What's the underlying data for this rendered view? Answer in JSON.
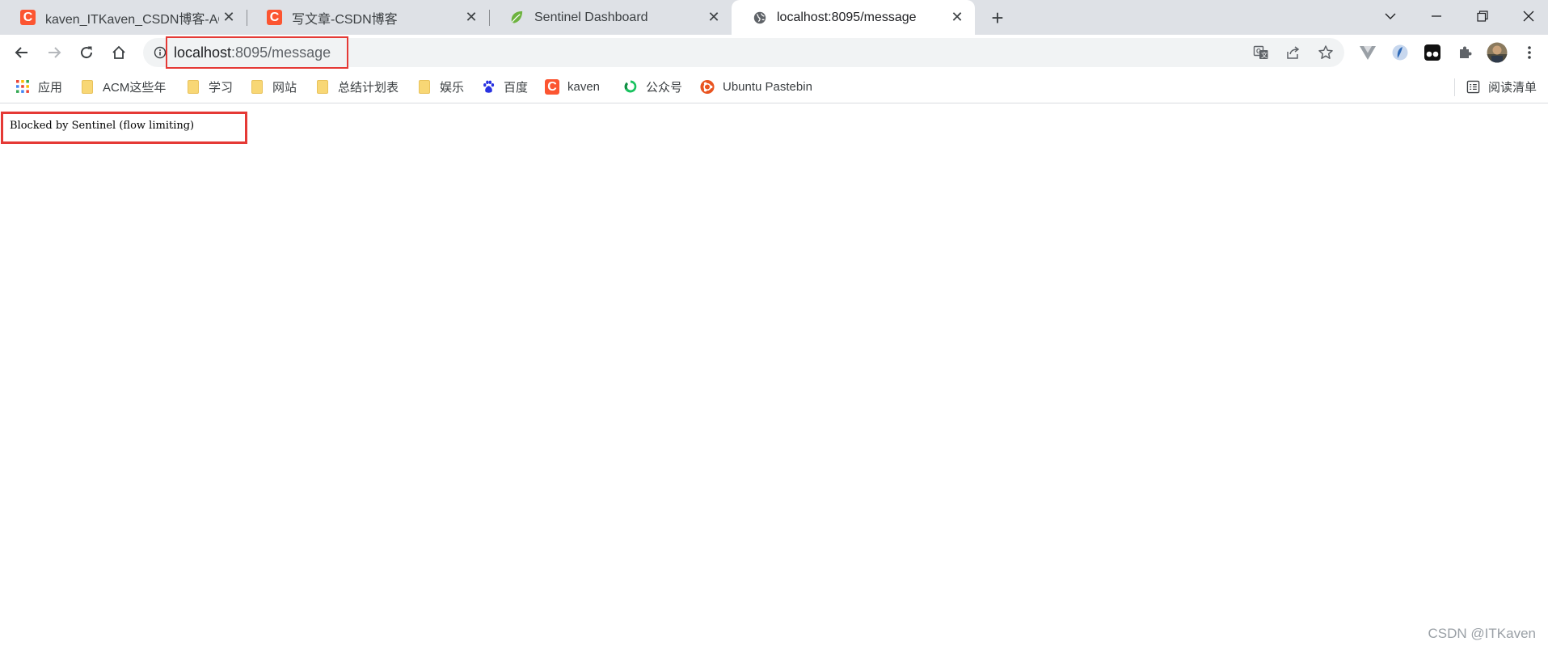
{
  "browser": {
    "tabs": [
      {
        "title": "kaven_ITKaven_CSDN博客-ACM",
        "icon": "csdn-icon",
        "favicon_char": "C",
        "active": false
      },
      {
        "title": "写文章-CSDN博客",
        "icon": "csdn-icon",
        "favicon_char": "C",
        "active": false
      },
      {
        "title": "Sentinel Dashboard",
        "icon": "spring-leaf-icon",
        "active": false
      },
      {
        "title": "localhost:8095/message",
        "icon": "globe-icon",
        "active": true
      }
    ],
    "close_glyph": "✕",
    "new_tab_glyph": "+",
    "window_controls": [
      "chevron-down-icon",
      "minimize-icon",
      "restore-icon",
      "close-icon"
    ]
  },
  "toolbar": {
    "url_host": "localhost",
    "url_rest": ":8095/message",
    "nav_icons": [
      "back-arrow-icon",
      "forward-arrow-icon",
      "reload-icon",
      "home-icon"
    ],
    "omnibox_icons": [
      "translate-icon",
      "share-icon",
      "star-icon"
    ],
    "extension_icons": [
      "vue-devtools-icon",
      "extension-blue-icon",
      "tampermonkey-icon",
      "puzzle-icon",
      "avatar",
      "more-menu-icon"
    ]
  },
  "bookmarks": {
    "items": [
      {
        "label": "应用",
        "icon": "apps-grid-icon"
      },
      {
        "label": "ACM这些年",
        "icon": "folder-icon"
      },
      {
        "label": "学习",
        "icon": "folder-icon"
      },
      {
        "label": "网站",
        "icon": "folder-icon"
      },
      {
        "label": "总结计划表",
        "icon": "folder-icon"
      },
      {
        "label": "娱乐",
        "icon": "folder-icon"
      },
      {
        "label": "百度",
        "icon": "baidu-paw-icon"
      },
      {
        "label": "kaven",
        "icon": "csdn-icon",
        "favicon_char": "C"
      },
      {
        "label": "公众号",
        "icon": "wechat-ring-icon"
      },
      {
        "label": "Ubuntu Pastebin",
        "icon": "ubuntu-icon"
      }
    ],
    "reading_list": {
      "label": "阅读清单",
      "icon": "reading-list-icon"
    }
  },
  "page": {
    "message": "Blocked by Sentinel (flow limiting)",
    "watermark": "CSDN @ITKaven"
  },
  "colors": {
    "highlight_box": "#e53935",
    "csdn_brand": "#fc5531",
    "tabstrip_bg": "#dee1e6"
  }
}
